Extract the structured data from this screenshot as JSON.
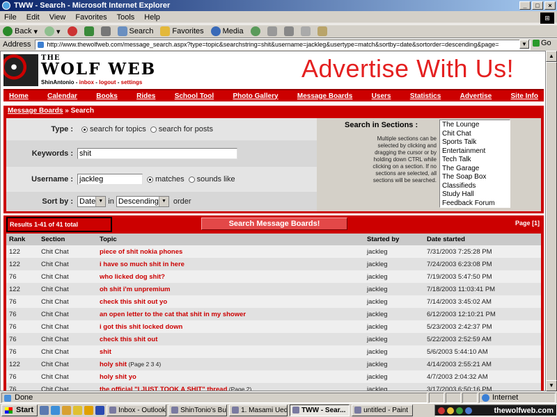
{
  "window": {
    "title": "TWW - Search - Microsoft Internet Explorer"
  },
  "menu": [
    "File",
    "Edit",
    "View",
    "Favorites",
    "Tools",
    "Help"
  ],
  "toolbar": {
    "back": "Back",
    "search": "Search",
    "favorites": "Favorites",
    "media": "Media"
  },
  "address": {
    "label": "Address",
    "url": "http://www.thewolfweb.com/message_search.aspx?type=topic&searchstring=shit&username=jackleg&usertype=match&sortby=date&sortorder=descending&page=",
    "go": "Go"
  },
  "site": {
    "logo_the": "THE",
    "logo_main": "WOLF WEB",
    "user": "ShinAntonio",
    "user_links": [
      "inbox",
      "logout",
      "settings"
    ],
    "advert": "Advertise With Us!",
    "nav": [
      "Home",
      "Calendar",
      "Books",
      "Rides",
      "School Tool",
      "Photo Gallery",
      "Message Boards",
      "Users",
      "Statistics",
      "Advertise",
      "Site Info"
    ],
    "breadcrumb": {
      "link": "Message Boards",
      "sep": " » ",
      "current": "Search"
    }
  },
  "form": {
    "type_label": "Type :",
    "type_topics": "search for topics",
    "type_posts": "search for posts",
    "keywords_label": "Keywords :",
    "keywords_value": "shit",
    "username_label": "Username :",
    "username_value": "jackleg",
    "matches": "matches",
    "sounds_like": "sounds like",
    "sortby_label": "Sort by :",
    "sort_field": "Date",
    "in": "in",
    "sort_order": "Descending",
    "order": "order",
    "sections_label": "Search in Sections :",
    "sections_hint": "Multiple sections can be selected by clicking and dragging the cursor or by holding down CTRL while clicking on a section. If no sections are selected, all sections will be searched.",
    "sections": [
      "The Lounge",
      "Chit Chat",
      "Sports Talk",
      "Entertainment",
      "Tech Talk",
      "The Garage",
      "The Soap Box",
      "Classifieds",
      "Study Hall",
      "Feedback Forum"
    ]
  },
  "results": {
    "count": "Results 1-41 of 41 total",
    "search_button": "Search Message Boards!",
    "page": "Page [1]",
    "headers": [
      "Rank",
      "Section",
      "Topic",
      "Started by",
      "Date started"
    ],
    "rows": [
      {
        "rank": "122",
        "section": "Chit Chat",
        "topic": "piece of shit nokia phones",
        "pages": "",
        "by": "jackleg",
        "date": "7/31/2003 7:25:28 PM"
      },
      {
        "rank": "122",
        "section": "Chit Chat",
        "topic": "i have so much shit in here",
        "pages": "",
        "by": "jackleg",
        "date": "7/24/2003 6:23:08 PM"
      },
      {
        "rank": "76",
        "section": "Chit Chat",
        "topic": "who licked dog shit?",
        "pages": "",
        "by": "jackleg",
        "date": "7/19/2003 5:47:50 PM"
      },
      {
        "rank": "122",
        "section": "Chit Chat",
        "topic": "oh shit i'm unpremium",
        "pages": "",
        "by": "jackleg",
        "date": "7/18/2003 11:03:41 PM"
      },
      {
        "rank": "76",
        "section": "Chit Chat",
        "topic": "check this shit out yo",
        "pages": "",
        "by": "jackleg",
        "date": "7/14/2003 3:45:02 AM"
      },
      {
        "rank": "76",
        "section": "Chit Chat",
        "topic": "an open letter to the cat that shit in my shower",
        "pages": "",
        "by": "jackleg",
        "date": "6/12/2003 12:10:21 PM"
      },
      {
        "rank": "76",
        "section": "Chit Chat",
        "topic": "i got this shit locked down",
        "pages": "",
        "by": "jackleg",
        "date": "5/23/2003 2:42:37 PM"
      },
      {
        "rank": "76",
        "section": "Chit Chat",
        "topic": "check this shit out",
        "pages": "",
        "by": "jackleg",
        "date": "5/22/2003 2:52:59 AM"
      },
      {
        "rank": "76",
        "section": "Chit Chat",
        "topic": "shit",
        "pages": "",
        "by": "jackleg",
        "date": "5/6/2003 5:44:10 AM"
      },
      {
        "rank": "122",
        "section": "Chit Chat",
        "topic": "holy shit",
        "pages": "(Page 2 3 4)",
        "by": "jackleg",
        "date": "4/14/2003 2:55:21 AM"
      },
      {
        "rank": "76",
        "section": "Chit Chat",
        "topic": "holy shit yo",
        "pages": "",
        "by": "jackleg",
        "date": "4/7/2003 2:04:32 AM"
      },
      {
        "rank": "76",
        "section": "Chit Chat",
        "topic": "the official \"I JUST TOOK A SHIT\" thread",
        "pages": "(Page 2)",
        "by": "jackleg",
        "date": "3/17/2003 6:50:16 PM"
      }
    ]
  },
  "status": {
    "text": "Done",
    "zone": "Internet"
  },
  "taskbar": {
    "start": "Start",
    "tasks": [
      "Inbox - Outlook ...",
      "ShinTonio's Bu...",
      "1. Masami Ued...",
      "TWW - Sear...",
      "untitled - Paint"
    ],
    "active_index": 3,
    "watermark": "thewolfweb.com"
  }
}
